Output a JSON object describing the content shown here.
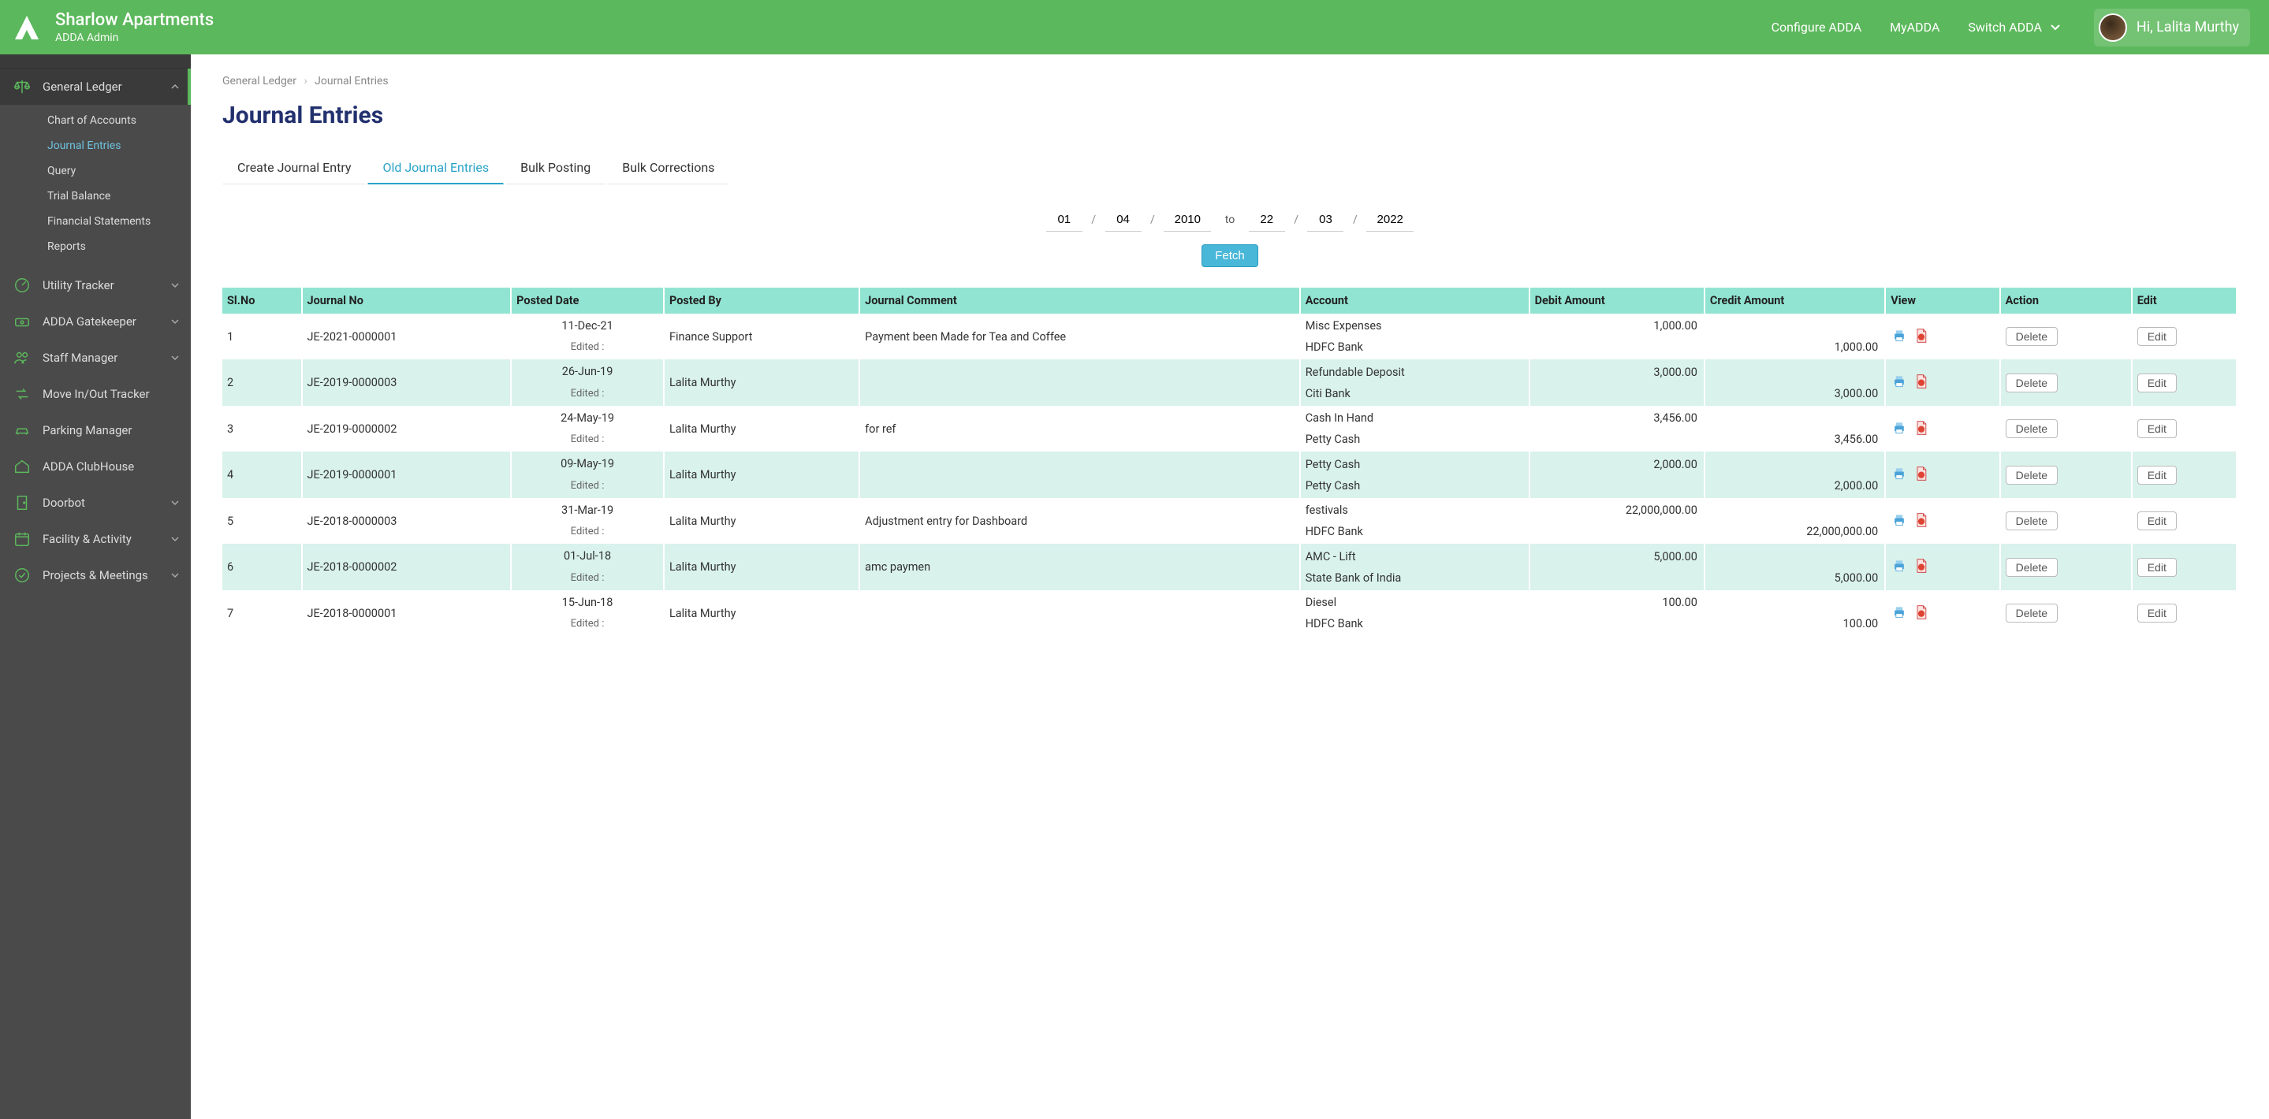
{
  "header": {
    "brand": "Sharlow Apartments",
    "sub": "ADDA Admin",
    "nav": {
      "configure": "Configure ADDA",
      "myadda": "MyADDA",
      "switch": "Switch ADDA"
    },
    "greeting": "Hi, Lalita Murthy"
  },
  "sidebar": {
    "active": "General Ledger",
    "sub": {
      "chart": "Chart of Accounts",
      "journal": "Journal Entries",
      "query": "Query",
      "trial": "Trial Balance",
      "fin": "Financial Statements",
      "reports": "Reports"
    },
    "items": {
      "utility": "Utility Tracker",
      "gatekeeper": "ADDA Gatekeeper",
      "staff": "Staff Manager",
      "move": "Move In/Out Tracker",
      "parking": "Parking Manager",
      "clubhouse": "ADDA ClubHouse",
      "doorbot": "Doorbot",
      "facility": "Facility & Activity",
      "projects": "Projects & Meetings"
    }
  },
  "breadcrumb": {
    "a": "General Ledger",
    "b": "Journal Entries"
  },
  "page_title": "Journal Entries",
  "tabs": {
    "create": "Create Journal Entry",
    "old": "Old Journal Entries",
    "bulk_post": "Bulk Posting",
    "bulk_corr": "Bulk Corrections"
  },
  "date": {
    "from_d": "01",
    "from_m": "04",
    "from_y": "2010",
    "to_label": "to",
    "to_d": "22",
    "to_m": "03",
    "to_y": "2022"
  },
  "fetch_label": "Fetch",
  "columns": {
    "slno": "Sl.No",
    "jno": "Journal No",
    "posted": "Posted Date",
    "by": "Posted By",
    "comment": "Journal Comment",
    "account": "Account",
    "debit": "Debit Amount",
    "credit": "Credit Amount",
    "view": "View",
    "action": "Action",
    "edit": "Edit"
  },
  "edited_label": "Edited :",
  "btn": {
    "delete": "Delete",
    "edit": "Edit"
  },
  "rows": [
    {
      "sl": "1",
      "jno": "JE-2021-0000001",
      "date": "11-Dec-21",
      "by": "Finance Support",
      "comment": "Payment been Made for Tea and Coffee",
      "lines": [
        {
          "account": "Misc Expenses",
          "debit": "1,000.00",
          "credit": ""
        },
        {
          "account": "HDFC Bank",
          "debit": "",
          "credit": "1,000.00"
        }
      ]
    },
    {
      "sl": "2",
      "jno": "JE-2019-0000003",
      "date": "26-Jun-19",
      "by": "Lalita Murthy",
      "comment": "",
      "lines": [
        {
          "account": "Refundable Deposit",
          "debit": "3,000.00",
          "credit": ""
        },
        {
          "account": "Citi Bank",
          "debit": "",
          "credit": "3,000.00"
        }
      ]
    },
    {
      "sl": "3",
      "jno": "JE-2019-0000002",
      "date": "24-May-19",
      "by": "Lalita Murthy",
      "comment": "for ref",
      "lines": [
        {
          "account": "Cash In Hand",
          "debit": "3,456.00",
          "credit": ""
        },
        {
          "account": "Petty Cash",
          "debit": "",
          "credit": "3,456.00"
        }
      ]
    },
    {
      "sl": "4",
      "jno": "JE-2019-0000001",
      "date": "09-May-19",
      "by": "Lalita Murthy",
      "comment": "",
      "lines": [
        {
          "account": "Petty Cash",
          "debit": "2,000.00",
          "credit": ""
        },
        {
          "account": "Petty Cash",
          "debit": "",
          "credit": "2,000.00"
        }
      ]
    },
    {
      "sl": "5",
      "jno": "JE-2018-0000003",
      "date": "31-Mar-19",
      "by": "Lalita Murthy",
      "comment": "Adjustment entry for Dashboard",
      "lines": [
        {
          "account": "festivals",
          "debit": "22,000,000.00",
          "credit": ""
        },
        {
          "account": "HDFC Bank",
          "debit": "",
          "credit": "22,000,000.00"
        }
      ]
    },
    {
      "sl": "6",
      "jno": "JE-2018-0000002",
      "date": "01-Jul-18",
      "by": "Lalita Murthy",
      "comment": "amc paymen",
      "lines": [
        {
          "account": "AMC - Lift",
          "debit": "5,000.00",
          "credit": ""
        },
        {
          "account": "State Bank of India",
          "debit": "",
          "credit": "5,000.00"
        }
      ]
    },
    {
      "sl": "7",
      "jno": "JE-2018-0000001",
      "date": "15-Jun-18",
      "by": "Lalita Murthy",
      "comment": "",
      "lines": [
        {
          "account": "Diesel",
          "debit": "100.00",
          "credit": ""
        },
        {
          "account": "HDFC Bank",
          "debit": "",
          "credit": "100.00"
        }
      ]
    }
  ]
}
